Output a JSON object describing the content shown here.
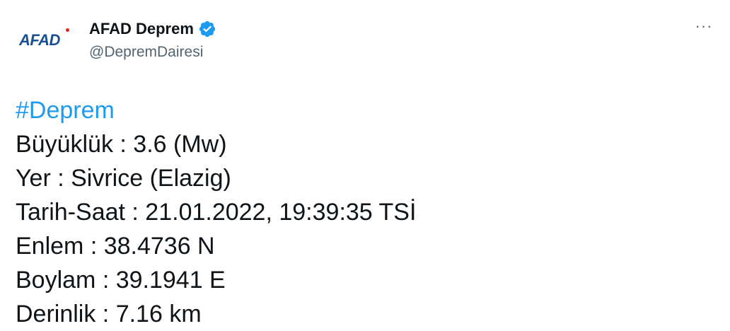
{
  "account": {
    "avatar_text": "AFAD",
    "display_name": "AFAD Deprem",
    "handle": "@DepremDairesi",
    "verified_icon": "verified-badge-icon"
  },
  "more_icon": "more-options-icon",
  "more_glyph": "···",
  "tweet": {
    "hashtag": "#Deprem",
    "lines": [
      "Büyüklük : 3.6 (Mw)",
      "Yer : Sivrice (Elazig)",
      "Tarih-Saat : 21.01.2022, 19:39:35 TSİ",
      "Enlem : 38.4736 N",
      "Boylam : 39.1941 E",
      "Derinlik : 7.16 km"
    ]
  },
  "colors": {
    "hashtag": "#1d9bf0",
    "verified": "#1d9bf0",
    "text": "#0f1419",
    "secondary": "#536471",
    "logo_blue": "#1a4f93",
    "logo_red": "#e2231a"
  }
}
